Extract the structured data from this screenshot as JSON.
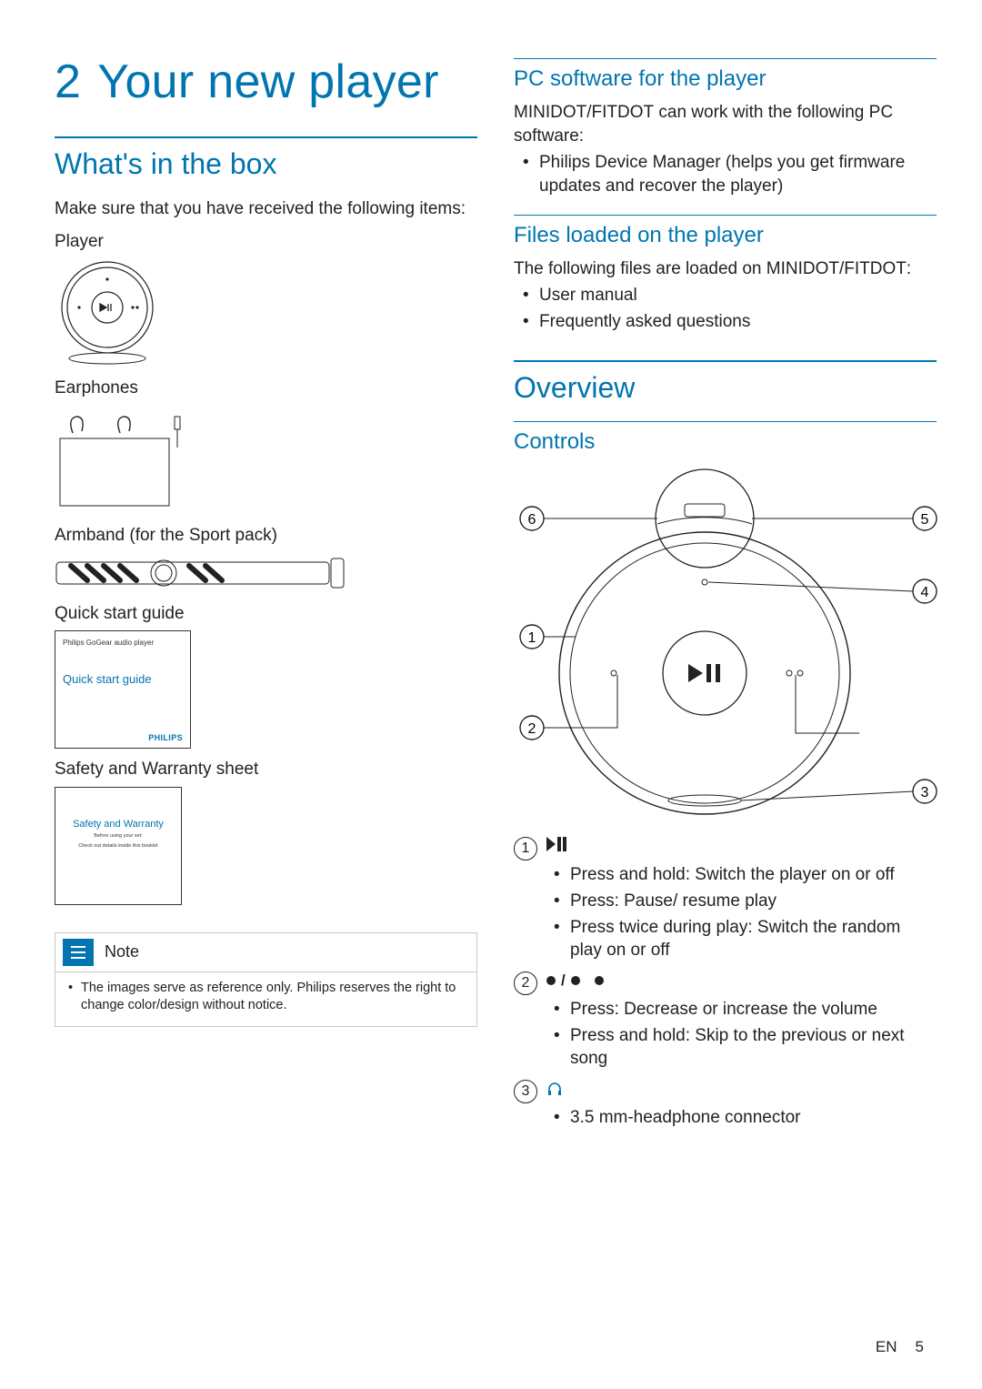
{
  "chapter": {
    "number": "2",
    "title": "Your new player"
  },
  "left": {
    "h2": "What's in the box",
    "intro": "Make sure that you have received the following items:",
    "items": {
      "player": "Player",
      "earphones": "Earphones",
      "armband": "Armband (for the Sport pack)",
      "qsg": "Quick start guide",
      "safety": "Safety and Warranty sheet"
    },
    "qsg_box": {
      "small": "Philips GoGear audio player",
      "title": "Quick start guide",
      "logo": "PHILIPS"
    },
    "sw_box": {
      "title": "Safety and Warranty",
      "sub1": "Before using your set:",
      "sub2": "Check out details inside this booklet"
    },
    "note": {
      "label": "Note",
      "text": "The images serve as reference only. Philips reserves the right to change color/design without notice."
    }
  },
  "right": {
    "pc": {
      "h3": "PC software for the player",
      "lead_a": "MINIDOT/FITDOT",
      "lead_b": " can work with the following PC software:",
      "bullet_strong": "Philips Device Manager",
      "bullet_rest": " (helps you get firmware updates and recover the player)"
    },
    "files": {
      "h3": "Files loaded on the player",
      "lead_a": "The following files are loaded on ",
      "lead_b": "MINIDOT/FITDOT",
      "lead_c": ":",
      "b1": "User manual",
      "b2": "Frequently asked questions"
    },
    "overview": {
      "h2": "Overview"
    },
    "controls": {
      "h3": "Controls",
      "c1": {
        "i1": "Press and hold: Switch the player on or off",
        "i2": "Press: Pause/ resume play",
        "i3": "Press twice during play: Switch the random play on or off"
      },
      "c2": {
        "slash": " / ",
        "i1": "Press: Decrease or increase the volume",
        "i2": "Press and hold: Skip to the previous or next song"
      },
      "c3": {
        "i1": "3.5 mm-headphone connector"
      }
    }
  },
  "footer": {
    "lang": "EN",
    "page": "5"
  }
}
